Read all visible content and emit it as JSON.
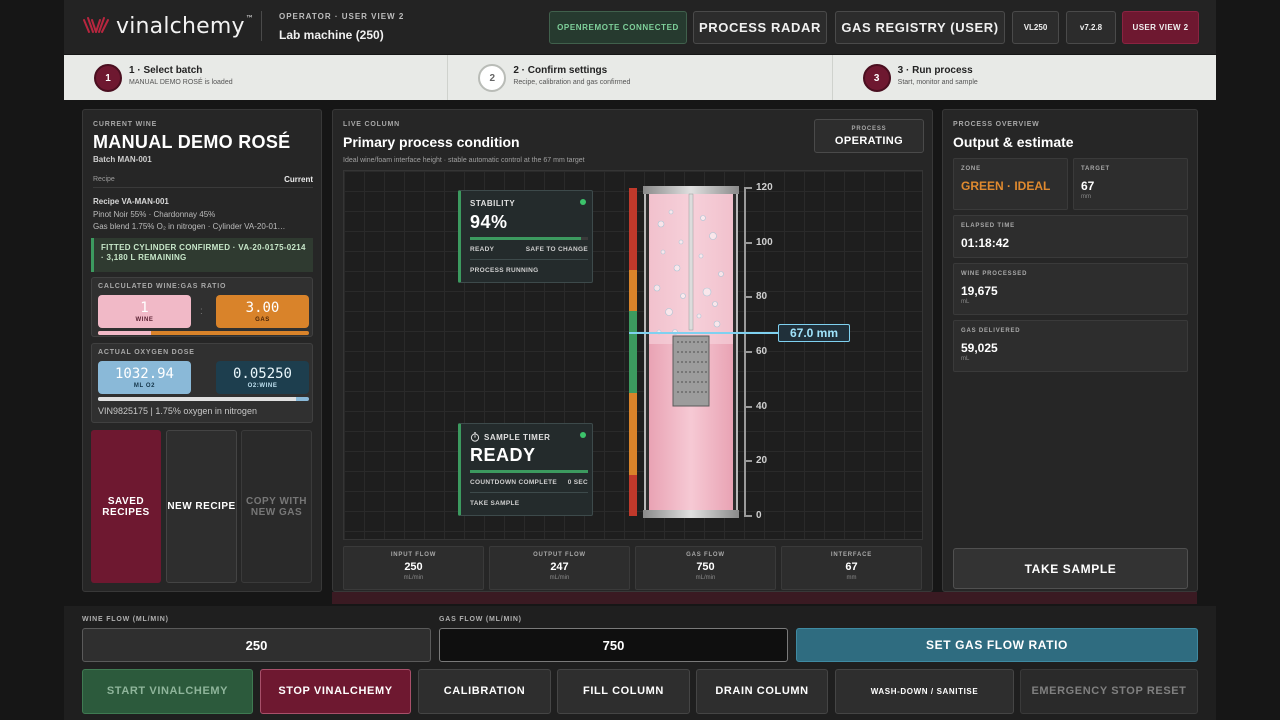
{
  "header": {
    "brand": "vinalchemy",
    "brand_tm": "™",
    "subtitle": "OPERATOR · USER VIEW 2",
    "machine": "Lab machine (250)",
    "connection": "OPENREMOTE CONNECTED",
    "process_radar": "PROCESS RADAR",
    "gas_registry": "GAS REGISTRY (USER)",
    "unit": "VL250",
    "version": "v7.2.8",
    "view": "USER VIEW 2"
  },
  "steps": [
    {
      "num": "1",
      "title": "1 · Select batch",
      "desc": "MANUAL DEMO ROSÉ is loaded",
      "state": "active"
    },
    {
      "num": "2",
      "title": "2 · Confirm settings",
      "desc": "Recipe, calibration and gas confirmed",
      "state": "idle"
    },
    {
      "num": "3",
      "title": "3 · Run process",
      "desc": "Start, monitor and sample",
      "state": "active"
    }
  ],
  "wine": {
    "label": "CURRENT WINE",
    "name": "MANUAL DEMO ROSÉ",
    "batch": "Batch MAN-001",
    "recipe_key": "Recipe",
    "recipe_val": "Current",
    "recipe_id": "Recipe VA-MAN-001",
    "blend": "Pinot Noir 55% · Chardonnay 45%",
    "gas_blend": "Gas blend 1.75% O₂ in nitrogen · Cylinder VA-20-01…",
    "confirm": "FITTED CYLINDER CONFIRMED · VA-20-0175-0214 · 3,180 L REMAINING"
  },
  "ratio": {
    "label": "CALCULATED WINE:GAS RATIO",
    "wine_value": "1",
    "wine_label": "WINE",
    "sep": ":",
    "gas_value": "3.00",
    "gas_label": "GAS",
    "wine_fraction": 0.25
  },
  "dose": {
    "label": "ACTUAL OXYGEN DOSE",
    "ml_value": "1032.94",
    "ml_label": "ML O2",
    "ratio_value": "0.05250",
    "ratio_label": "O2:WINE",
    "fill_fraction": 0.94,
    "footnote": "VIN9825175 | 1.75% oxygen in nitrogen"
  },
  "left_buttons": {
    "saved": "SAVED RECIPES",
    "new": "NEW RECIPE",
    "copy": "COPY WITH NEW GAS"
  },
  "live": {
    "label": "LIVE COLUMN",
    "title": "Primary process condition",
    "subtitle": "Ideal wine/foam interface height · stable automatic control at the 67 mm target",
    "process_label": "PROCESS",
    "process_state": "OPERATING",
    "interface_value": 67.0,
    "interface_text": "67.0 mm",
    "axis_min": 0,
    "axis_max": 120,
    "ticks": [
      "120",
      "100",
      "80",
      "60",
      "40",
      "20",
      "0"
    ],
    "zone_colors": [
      "#c0392b",
      "#c0392b",
      "#d9832a",
      "#3c9a5f",
      "#3c9a5f",
      "#d9832a",
      "#d9832a",
      "#c0392b"
    ]
  },
  "stability": {
    "label": "STABILITY",
    "value": "94%",
    "fraction": 0.94,
    "ready": "READY",
    "safe": "SAFE TO CHANGE",
    "running": "PROCESS RUNNING"
  },
  "sample_timer": {
    "label": "SAMPLE TIMER",
    "value": "READY",
    "countdown": "COUNTDOWN COMPLETE",
    "countdown_tail": "0 SEC",
    "take": "TAKE SAMPLE"
  },
  "metrics": [
    {
      "label": "INPUT FLOW",
      "value": "250",
      "unit": "mL/min"
    },
    {
      "label": "OUTPUT FLOW",
      "value": "247",
      "unit": "mL/min"
    },
    {
      "label": "GAS FLOW",
      "value": "750",
      "unit": "mL/min"
    },
    {
      "label": "INTERFACE",
      "value": "67",
      "unit": "mm"
    }
  ],
  "overview": {
    "label": "PROCESS OVERVIEW",
    "title": "Output & estimate",
    "zone_label": "ZONE",
    "zone_value": "GREEN · IDEAL",
    "target_label": "TARGET",
    "target_value": "67",
    "target_unit": "mm",
    "elapsed_label": "ELAPSED TIME",
    "elapsed_value": "01:18:42",
    "wine_label": "WINE PROCESSED",
    "wine_value": "19,675",
    "wine_unit": "mL",
    "gas_label": "GAS DELIVERED",
    "gas_value": "59,025",
    "gas_unit": "mL",
    "take_sample": "TAKE SAMPLE"
  },
  "controls": {
    "wine_flow_label": "WINE FLOW (ML/MIN)",
    "wine_flow_value": "250",
    "gas_flow_label": "GAS FLOW (ML/MIN)",
    "gas_flow_value": "750",
    "set_ratio": "SET GAS FLOW RATIO",
    "start": "START VINALCHEMY",
    "stop": "STOP VINALCHEMY",
    "calibration": "CALIBRATION",
    "fill": "FILL COLUMN",
    "drain": "DRAIN COLUMN",
    "wash": "WASH-DOWN / SANITISE",
    "estop": "EMERGENCY STOP RESET"
  },
  "colors": {
    "brand": "#6e1830",
    "ok": "#3c9a5f",
    "warn": "#d9832a",
    "info": "#2f6c80",
    "interface": "#7fd1f0"
  }
}
